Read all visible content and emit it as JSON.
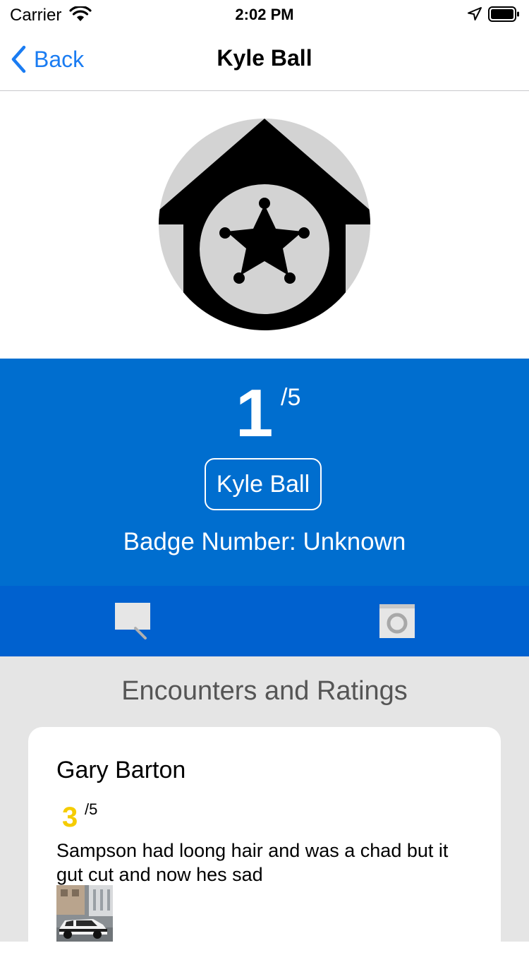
{
  "status_bar": {
    "carrier": "Carrier",
    "time": "2:02 PM"
  },
  "nav": {
    "back_label": "Back",
    "title": "Kyle Ball"
  },
  "officer": {
    "rating": "1",
    "rating_max": "/5",
    "name": "Kyle Ball",
    "badge": "Badge Number: Unknown"
  },
  "tabs": [
    {
      "icon": "comment-icon"
    },
    {
      "icon": "camera-icon"
    }
  ],
  "encounters": {
    "heading": "Encounters and Ratings",
    "items": [
      {
        "name": "Gary Barton",
        "rating": "3",
        "rating_max": "/5",
        "text": " Sampson had loong hair and was a chad but it gut cut and now hes sad"
      }
    ]
  },
  "colors": {
    "accent": "#1a7cf2",
    "rating_bg": "#006ecf",
    "tab_bg": "#0061cf",
    "star_rating": "#f5cc00",
    "list_bg": "#e5e5e5"
  }
}
